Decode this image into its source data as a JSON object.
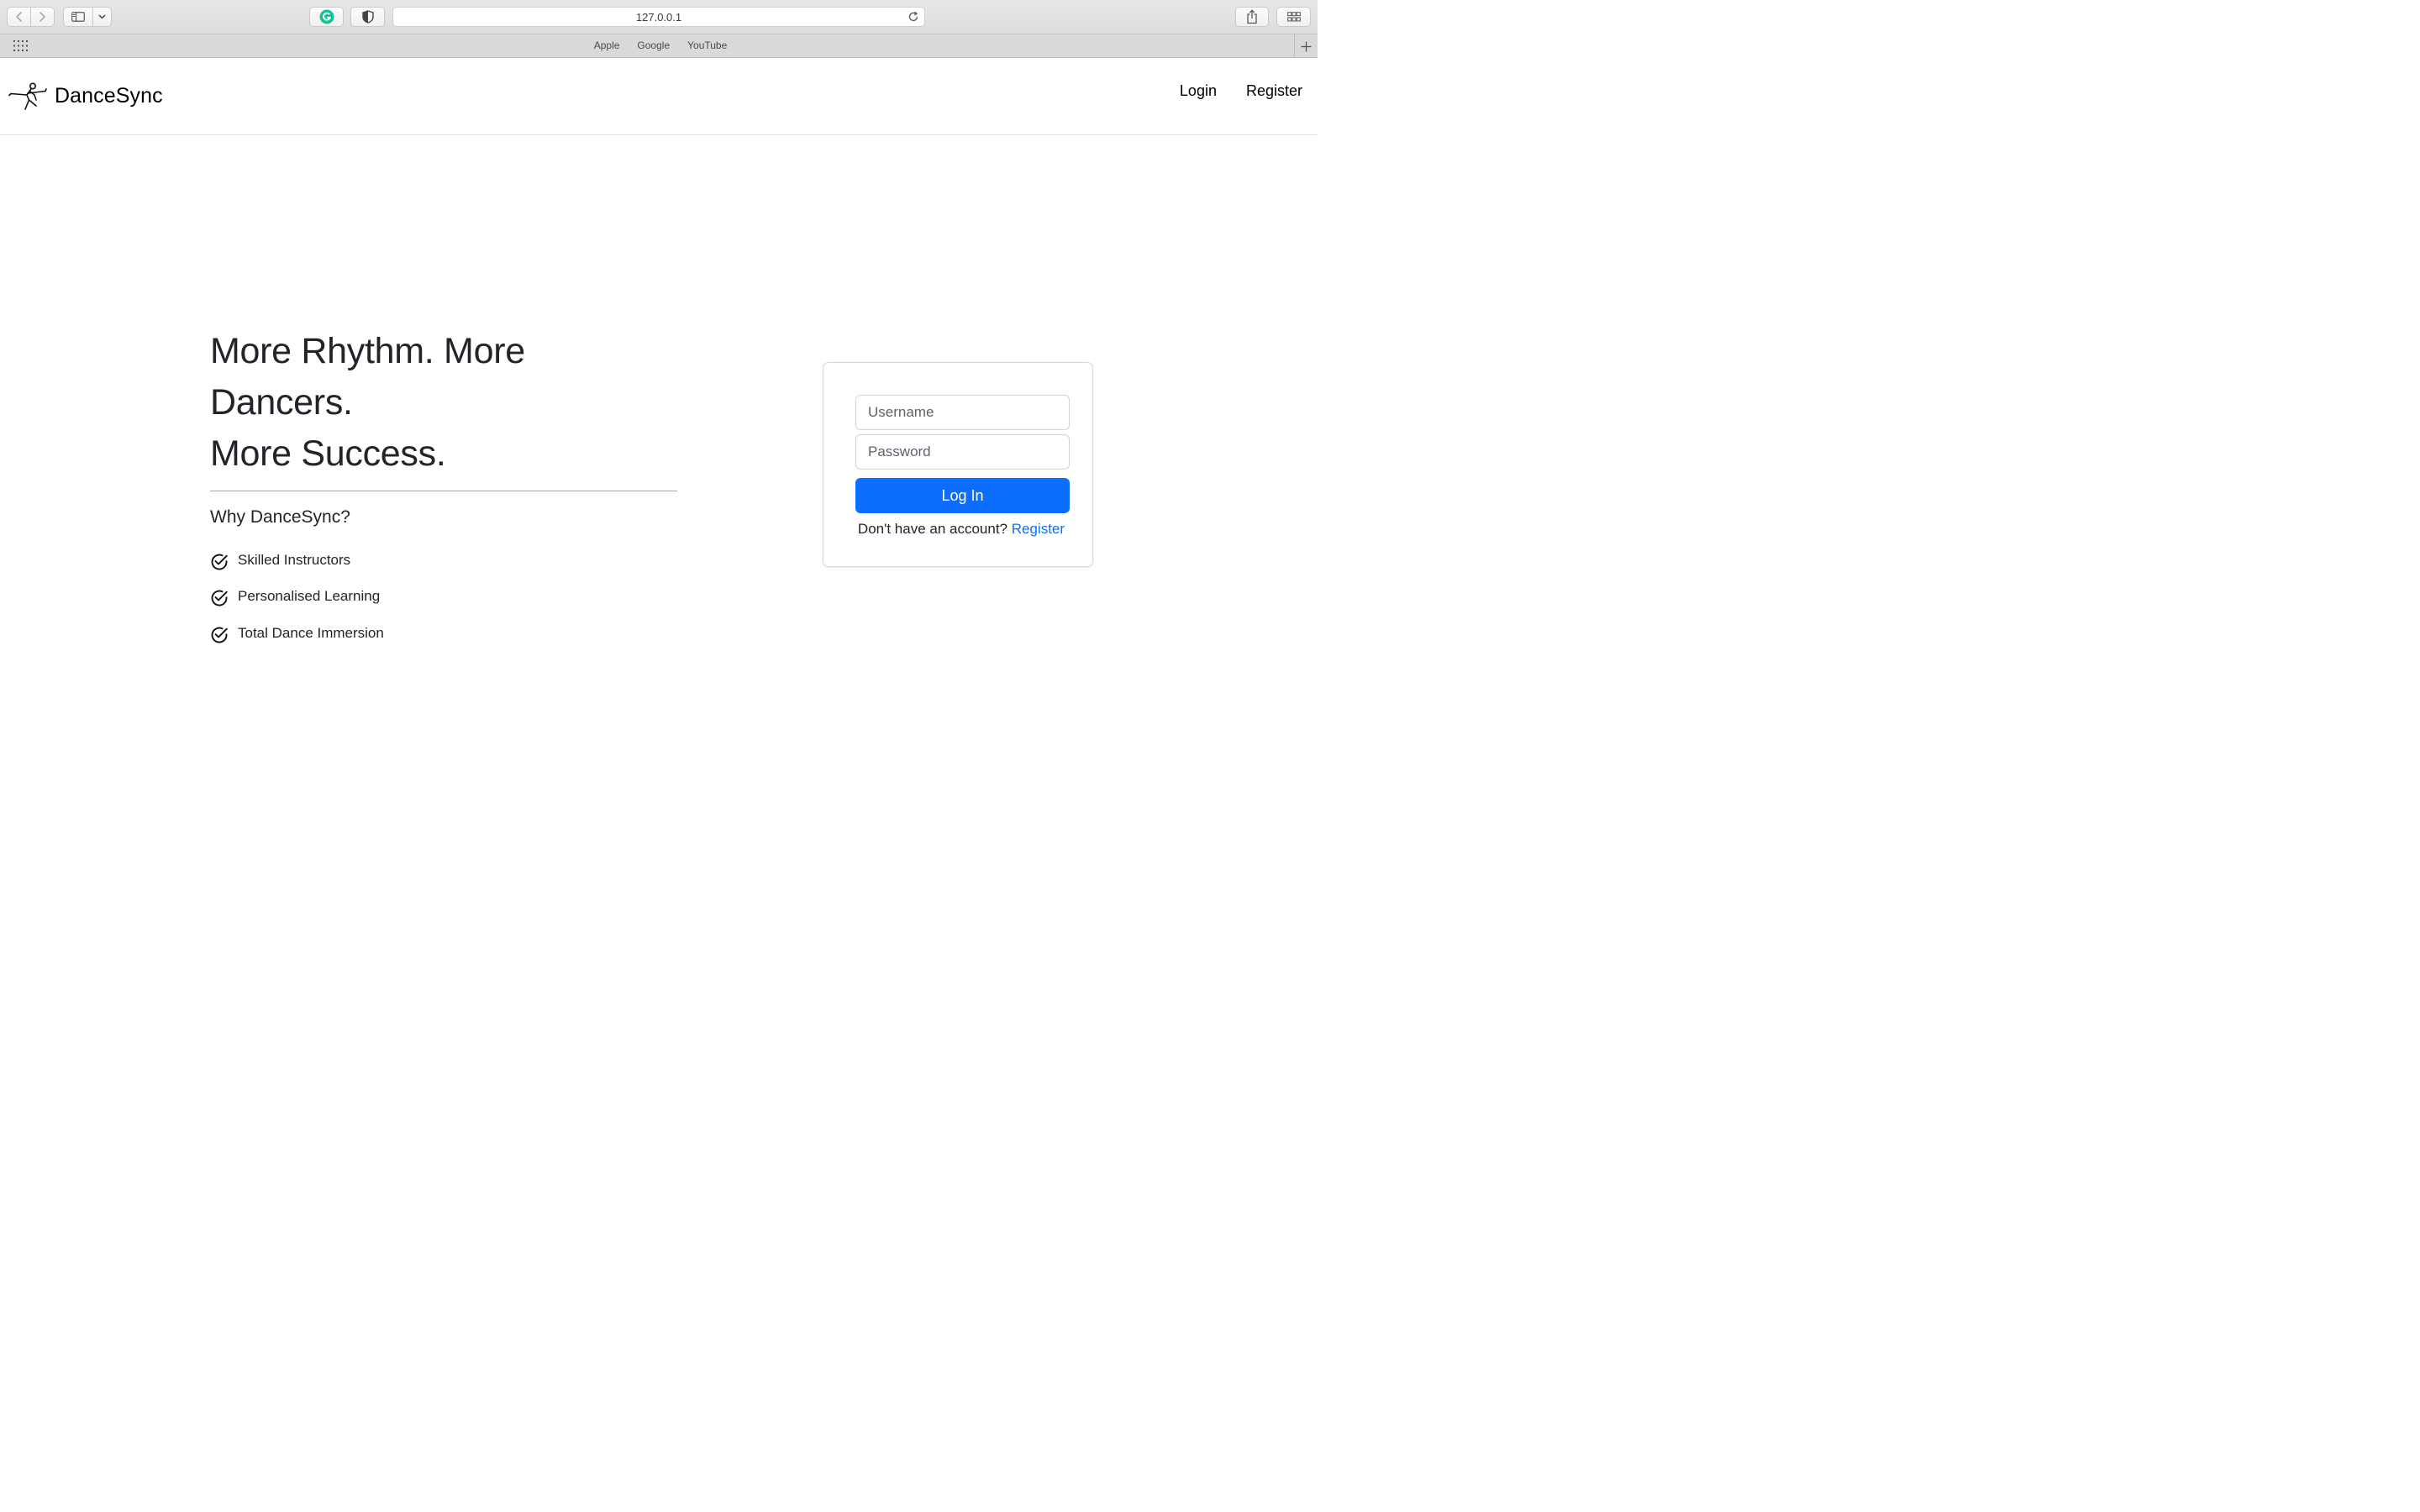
{
  "browser": {
    "url": "127.0.0.1",
    "favorites": [
      "Apple",
      "Google",
      "YouTube"
    ]
  },
  "site": {
    "brand": "DanceSync",
    "nav": {
      "login": "Login",
      "register": "Register"
    }
  },
  "hero": {
    "title_line1": "More Rhythm. More Dancers.",
    "title_line2": "More Success.",
    "why_title": "Why DanceSync?",
    "features": [
      "Skilled Instructors",
      "Personalised Learning",
      "Total Dance Immersion"
    ]
  },
  "login_form": {
    "username_placeholder": "Username",
    "password_placeholder": "Password",
    "submit_label": "Log In",
    "no_account_text": "Don't have an account?",
    "register_link": "Register"
  },
  "colors": {
    "primary": "#0d6efd",
    "text": "#212529",
    "grammarly": "#15c39a"
  }
}
